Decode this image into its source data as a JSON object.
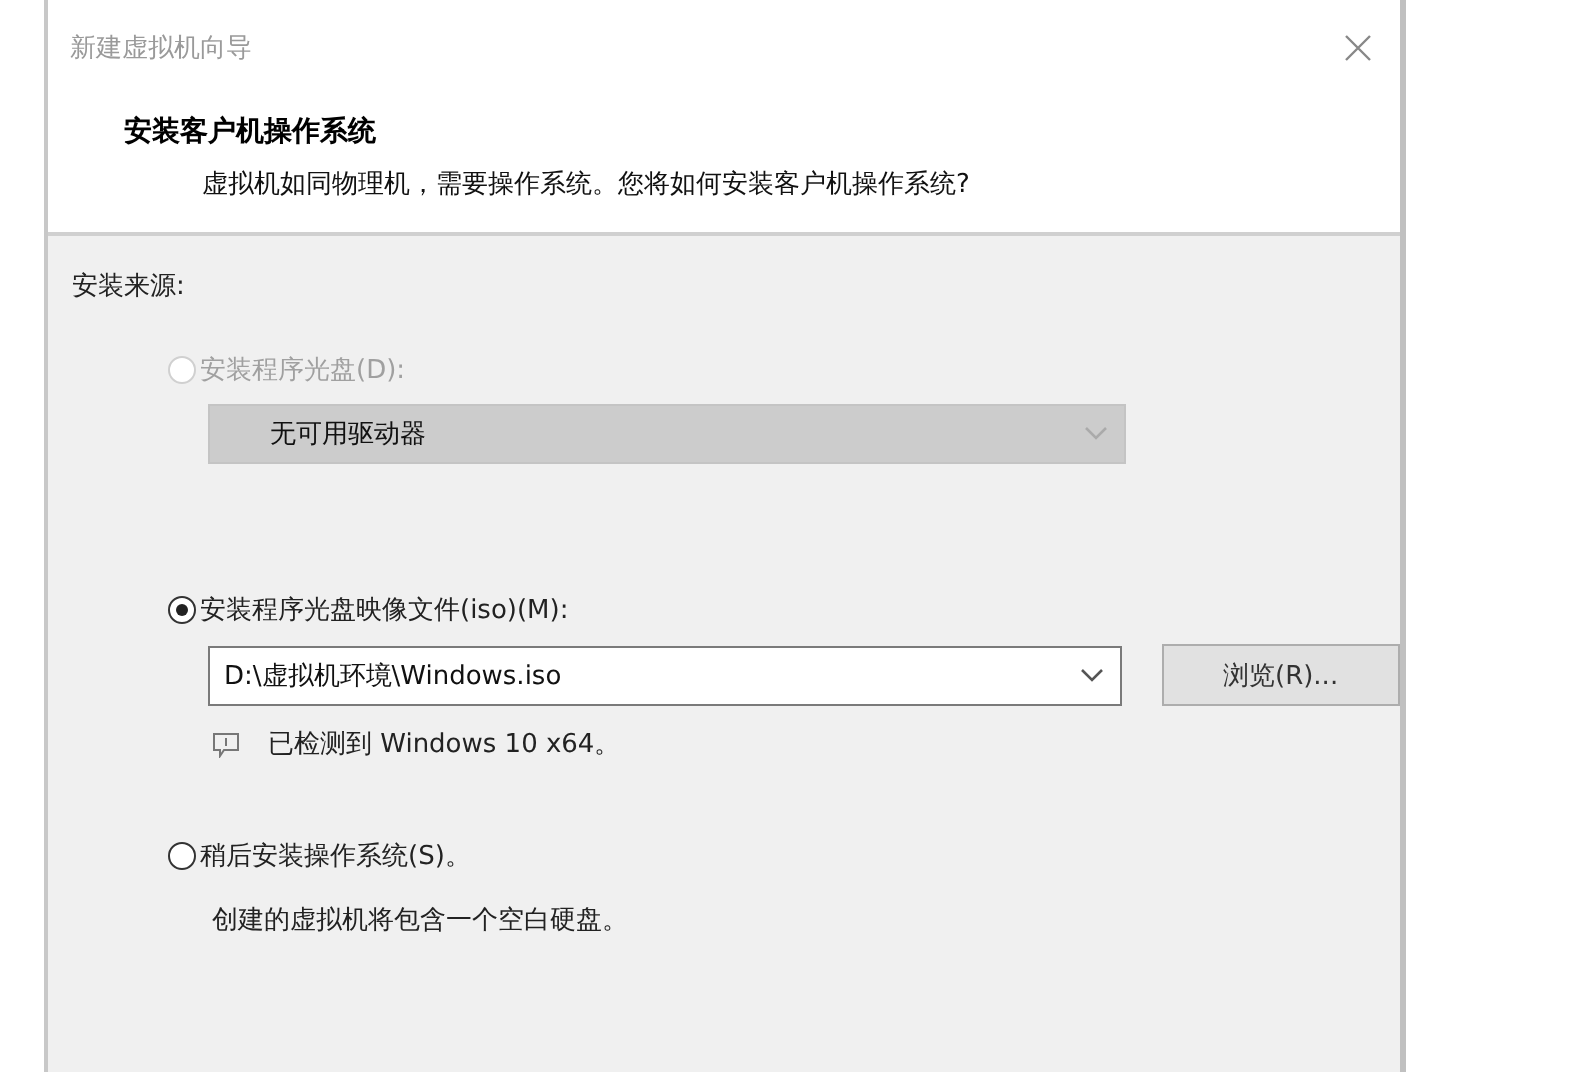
{
  "window": {
    "title": "新建虚拟机向导"
  },
  "header": {
    "title": "安装客户机操作系统",
    "subtitle": "虚拟机如同物理机，需要操作系统。您将如何安装客户机操作系统?"
  },
  "section_label": "安装来源:",
  "options": [
    {
      "kind": "disc",
      "label": "安装程序光盘(D):",
      "selected": false,
      "disabled": true,
      "combo_value": "无可用驱动器"
    },
    {
      "kind": "iso",
      "label": "安装程序光盘映像文件(iso)(M):",
      "selected": true,
      "disabled": false,
      "path_value": "D:\\虚拟机环境\\Windows.iso",
      "browse_label": "浏览(R)...",
      "note": "已检测到 Windows 10 x64。"
    },
    {
      "kind": "later",
      "label": "稍后安装操作系统(S)。",
      "selected": false,
      "disabled": false,
      "description": "创建的虚拟机将包含一个空白硬盘。"
    }
  ]
}
